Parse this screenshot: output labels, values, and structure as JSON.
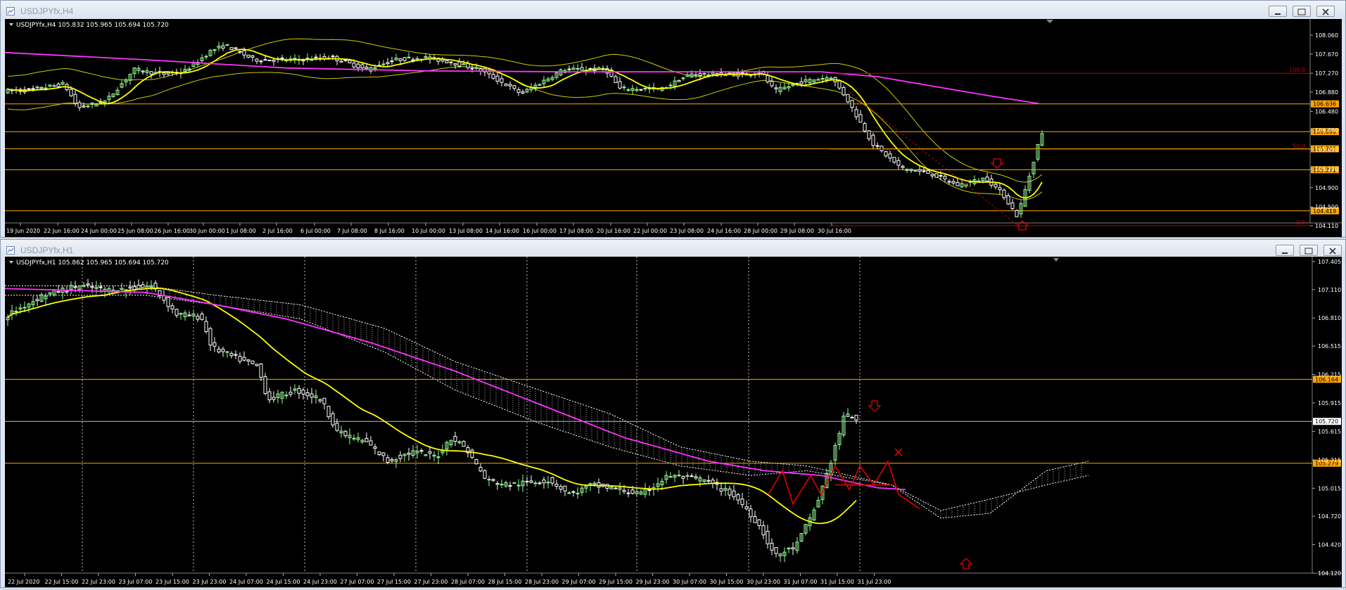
{
  "windows": [
    {
      "title": "USDJPYfx,H4",
      "info": "USDJPYfx,H4  105.832 105.965 105.694 105.720",
      "price_axis": [
        "108.060",
        "107.670",
        "107.270",
        "106.880",
        "106.480",
        "106.090",
        "105.690",
        "105.290",
        "104.900",
        "104.500",
        "104.110"
      ],
      "time_axis": [
        "19 Jun 2020",
        "22 Jun 16:00",
        "24 Jun 00:00",
        "25 Jun 08:00",
        "26 Jun 16:00",
        "30 Jun 00:00",
        "1 Jul 08:00",
        "2 Jul 16:00",
        "6 Jul 00:00",
        "7 Jul 08:00",
        "8 Jul 16:00",
        "10 Jul 00:00",
        "13 Jul 08:00",
        "14 Jul 16:00",
        "16 Jul 00:00",
        "17 Jul 08:00",
        "20 Jul 16:00",
        "22 Jul 00:00",
        "23 Jul 08:00",
        "24 Jul 16:00",
        "28 Jul 00:00",
        "29 Jul 08:00",
        "30 Jul 16:00"
      ],
      "levels": [
        {
          "price": "106.636",
          "color": "#ffa500"
        },
        {
          "price": "106.060",
          "color": "#ffa500"
        },
        {
          "price": "105.705",
          "color": "#ffa500"
        },
        {
          "price": "105.271",
          "color": "#ffa500"
        },
        {
          "price": "104.419",
          "color": "#ffa500"
        }
      ],
      "fibo_labels": [
        "100.0",
        "50.0",
        "0.0"
      ],
      "colors": {
        "bull": "#98fb98",
        "bear": "#ffffff",
        "ma_fast": "#ffff00",
        "ma_slow": "#ff33ff",
        "bands": "#cccc00",
        "fibo": "#cc0000",
        "arrow": "#e00000"
      }
    },
    {
      "title": "USDJPYfx,H1",
      "info": "USDJPYfx,H1  105.862 105.965 105.694 105.720",
      "price_axis": [
        "107.405",
        "107.110",
        "106.810",
        "106.515",
        "106.215",
        "105.915",
        "105.615",
        "105.315",
        "105.015",
        "104.720",
        "104.420",
        "104.120"
      ],
      "time_axis": [
        "22 Jul 2020",
        "22 Jul 15:00",
        "22 Jul 23:00",
        "23 Jul 07:00",
        "23 Jul 15:00",
        "23 Jul 23:00",
        "24 Jul 07:00",
        "24 Jul 15:00",
        "24 Jul 23:00",
        "27 Jul 07:00",
        "27 Jul 15:00",
        "27 Jul 23:00",
        "28 Jul 07:00",
        "28 Jul 15:00",
        "28 Jul 23:00",
        "29 Jul 07:00",
        "29 Jul 15:00",
        "29 Jul 23:00",
        "30 Jul 07:00",
        "30 Jul 15:00",
        "30 Jul 23:00",
        "31 Jul 07:00",
        "31 Jul 15:00",
        "31 Jul 23:00"
      ],
      "levels": [
        {
          "price": "106.164",
          "color": "#ffa500"
        },
        {
          "price": "105.720",
          "color": "#c0c0c0"
        },
        {
          "price": "105.279",
          "color": "#ffa500"
        }
      ],
      "colors": {
        "bull": "#98fb98",
        "bear": "#ffffff",
        "ma_fast": "#ffff00",
        "ma_slow": "#ff33ff",
        "cloud": "#ffffff",
        "zigzag": "#e00000",
        "arrow": "#e00000"
      }
    }
  ]
}
